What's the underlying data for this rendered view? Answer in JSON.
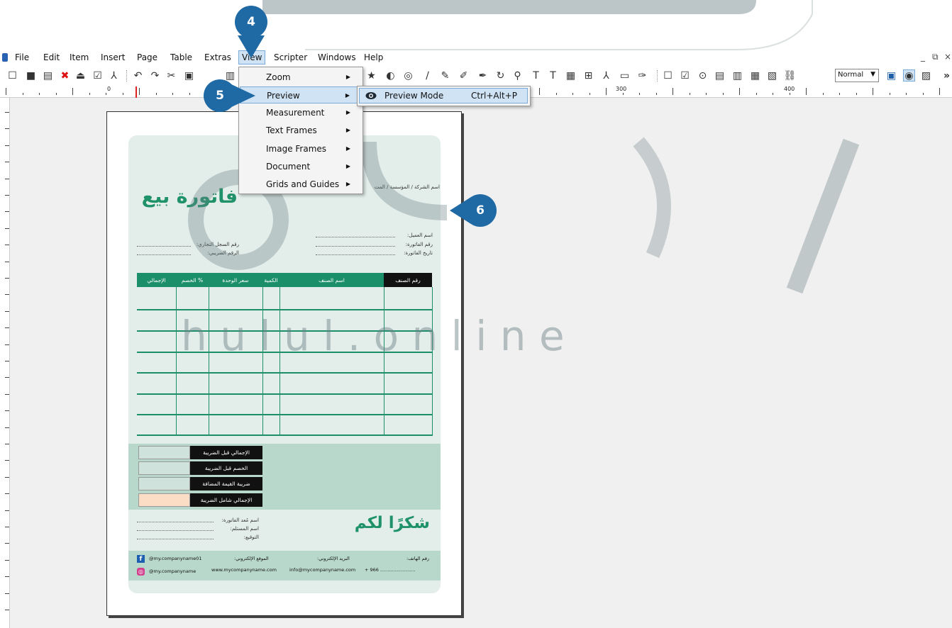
{
  "menubar": {
    "items": [
      "File",
      "Edit",
      "Item",
      "Insert",
      "Page",
      "Table",
      "Extras",
      "View",
      "Scripter",
      "Windows",
      "Help"
    ],
    "window_controls": [
      "_",
      "⧉",
      "×"
    ]
  },
  "toolbar": {
    "render_mode": "Normal"
  },
  "ruler": {
    "labels": [
      "0",
      "300",
      "400"
    ]
  },
  "view_menu": {
    "items": [
      {
        "label": "Zoom"
      },
      {
        "label": "Preview"
      },
      {
        "label": "Measurement"
      },
      {
        "label": "Text Frames"
      },
      {
        "label": "Image Frames"
      },
      {
        "label": "Document"
      },
      {
        "label": "Grids and Guides"
      }
    ]
  },
  "preview_submenu": {
    "label": "Preview Mode",
    "shortcut": "Ctrl+Alt+P"
  },
  "callouts": {
    "step4": "4",
    "step5": "5",
    "step6": "6"
  },
  "invoice": {
    "title": "فاتورة بيع",
    "company_line": "اسم الشركة / المؤسسة / المت",
    "fields_right": [
      "اسم العميل:",
      "رقم الفاتورة:",
      "تاريخ الفاتورة:"
    ],
    "fields_left": [
      "رقم السجل التجاري:",
      "الرقم الضريبي:"
    ],
    "columns": [
      "رقم الصنف",
      "اسم الصنف",
      "الكمية",
      "سعر الوحدة",
      "الخصم %",
      "الإجمالي"
    ],
    "totals": [
      "الإجمالي قبل الضريبة",
      "الخصم قبل الضريبة",
      "ضريبة القيمة المضافة",
      "الإجمالي شامل الضريبة"
    ],
    "thanks": "شكرًا لكم",
    "sign_fields": [
      "اسم مُعد الفاتورة:",
      "اسم المستلم:",
      "التوقيع:"
    ],
    "footer": {
      "facebook": "@my.companyname01",
      "instagram": "@my.companyname",
      "website_label": "الموقع الإلكتروني:",
      "website": "www.mycompanyname.com",
      "email_label": "البريد الإلكتروني:",
      "email": "info@mycompanyname.com",
      "phone_label": "رقم الهاتف:",
      "phone": "+ 966 ........................"
    }
  },
  "watermark": {
    "latin": "h u l u l . o n l i n e"
  },
  "colors": {
    "accent_green": "#1b8e6a",
    "callout_blue": "#1f6aa5",
    "menu_highlight": "#cfe3f5"
  }
}
